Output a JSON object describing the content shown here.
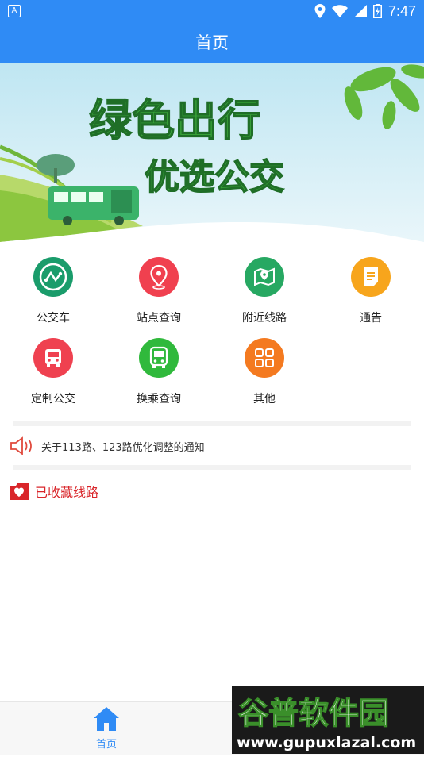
{
  "status_bar": {
    "time": "7:47",
    "app_icon_letter": "A"
  },
  "header": {
    "title": "首页"
  },
  "banner": {
    "line1": "绿色出行",
    "line2": "优选公交"
  },
  "menu": {
    "items": [
      {
        "label": "公交车",
        "icon": "route-icon",
        "color": "#1a9c6b"
      },
      {
        "label": "站点查询",
        "icon": "location-pin-icon",
        "color": "#f0404f"
      },
      {
        "label": "附近线路",
        "icon": "map-icon",
        "color": "#27a862"
      },
      {
        "label": "通告",
        "icon": "document-icon",
        "color": "#f7a51c"
      },
      {
        "label": "定制公交",
        "icon": "bus-icon",
        "color": "#ef4150"
      },
      {
        "label": "换乘查询",
        "icon": "bus-front-icon",
        "color": "#30b93c"
      },
      {
        "label": "其他",
        "icon": "grid-icon",
        "color": "#f47a20"
      }
    ]
  },
  "notice": {
    "text": "关于113路、123路优化调整的通知",
    "icon": "speaker-icon"
  },
  "favorites": {
    "label": "已收藏线路",
    "icon": "heart-folder-icon"
  },
  "bottom_nav": {
    "home_label": "首页",
    "home_icon": "home-icon"
  },
  "watermark": {
    "line1": "谷普软件园",
    "line2": "www.gupuxlazal.com"
  },
  "colors": {
    "primary": "#2f8bf5",
    "fav_red": "#d9252a"
  }
}
